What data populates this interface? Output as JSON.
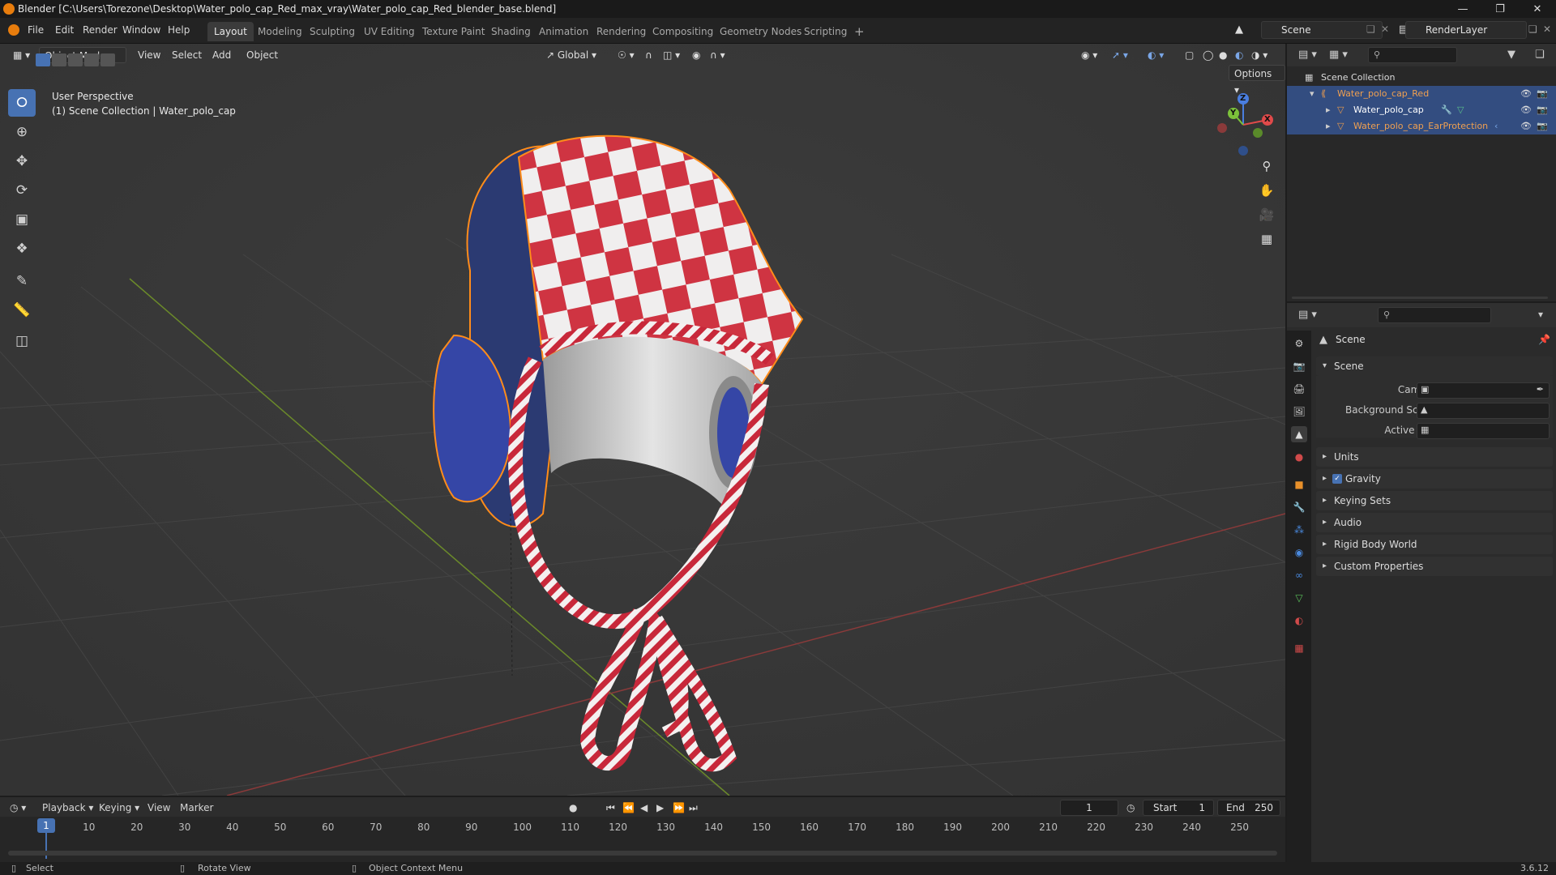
{
  "window": {
    "title": "Blender [C:\\Users\\Torezone\\Desktop\\Water_polo_cap_Red_max_vray\\Water_polo_cap_Red_blender_base.blend]"
  },
  "menu": [
    "File",
    "Edit",
    "Render",
    "Window",
    "Help"
  ],
  "workspaces": [
    "Layout",
    "Modeling",
    "Sculpting",
    "UV Editing",
    "Texture Paint",
    "Shading",
    "Animation",
    "Rendering",
    "Compositing",
    "Geometry Nodes",
    "Scripting"
  ],
  "active_workspace": "Layout",
  "scene_selector": "Scene",
  "view_layer": "RenderLayer",
  "viewport": {
    "mode": "Object Mode",
    "header_menus": [
      "View",
      "Select",
      "Add",
      "Object"
    ],
    "transform_orientation": "Global",
    "options_label": "Options",
    "overlay_line1": "User Perspective",
    "overlay_line2": "(1) Scene Collection | Water_polo_cap",
    "gizmo": {
      "z": "Z",
      "x": "X",
      "y": "Y"
    }
  },
  "outliner": {
    "root": "Scene Collection",
    "items": [
      {
        "name": "Water_polo_cap_Red"
      },
      {
        "name": "Water_polo_cap"
      },
      {
        "name": "Water_polo_cap_EarProtection"
      }
    ]
  },
  "properties": {
    "context": "Scene",
    "section": "Scene",
    "fields": {
      "camera_label": "Camera",
      "background_label": "Background Scene",
      "clip_label": "Active Clip"
    },
    "panels": [
      "Units",
      "Gravity",
      "Keying Sets",
      "Audio",
      "Rigid Body World",
      "Custom Properties"
    ],
    "gravity_enabled": true
  },
  "timeline": {
    "menus": [
      "Playback",
      "Keying",
      "View",
      "Marker"
    ],
    "current_frame": "1",
    "start_label": "Start",
    "start": "1",
    "end_label": "End",
    "end": "250",
    "ticks": [
      "10",
      "20",
      "30",
      "40",
      "50",
      "60",
      "70",
      "80",
      "90",
      "100",
      "110",
      "120",
      "130",
      "140",
      "150",
      "160",
      "170",
      "180",
      "190",
      "200",
      "210",
      "220",
      "230",
      "240",
      "250"
    ],
    "playhead_label": "1"
  },
  "status": {
    "select": "Select",
    "rotate": "Rotate View",
    "context_menu": "Object Context Menu",
    "version": "3.6.12"
  }
}
